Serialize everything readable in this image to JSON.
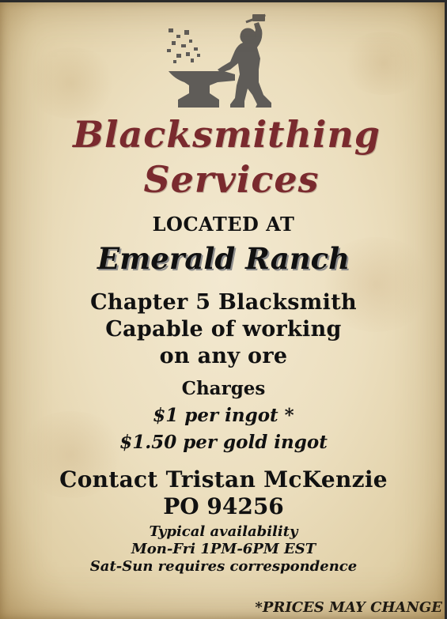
{
  "poster": {
    "title_line1": "Blacksmithing",
    "title_line2": "Services",
    "located_label": "LOCATED AT",
    "location": "Emerald Ranch",
    "details": [
      "Chapter 5 Blacksmith",
      "Capable of working",
      "on any ore"
    ],
    "charges_label": "Charges",
    "prices": [
      "$1 per ingot *",
      "$1.50 per gold ingot"
    ],
    "contact": "Contact Tristan McKenzie",
    "po_box": "PO 94256",
    "availability": {
      "heading": "Typical availability",
      "weekdays": "Mon-Fri 1PM-6PM EST",
      "weekend": "Sat-Sun requires correspondence"
    },
    "footnote": "*PRICES MAY CHANGE"
  },
  "colors": {
    "title": "#7a2a2e",
    "text": "#111111",
    "paper": "#ecdfbf",
    "silhouette": "#5f5c58"
  },
  "icons": {
    "logo": "blacksmith-anvil-icon"
  }
}
